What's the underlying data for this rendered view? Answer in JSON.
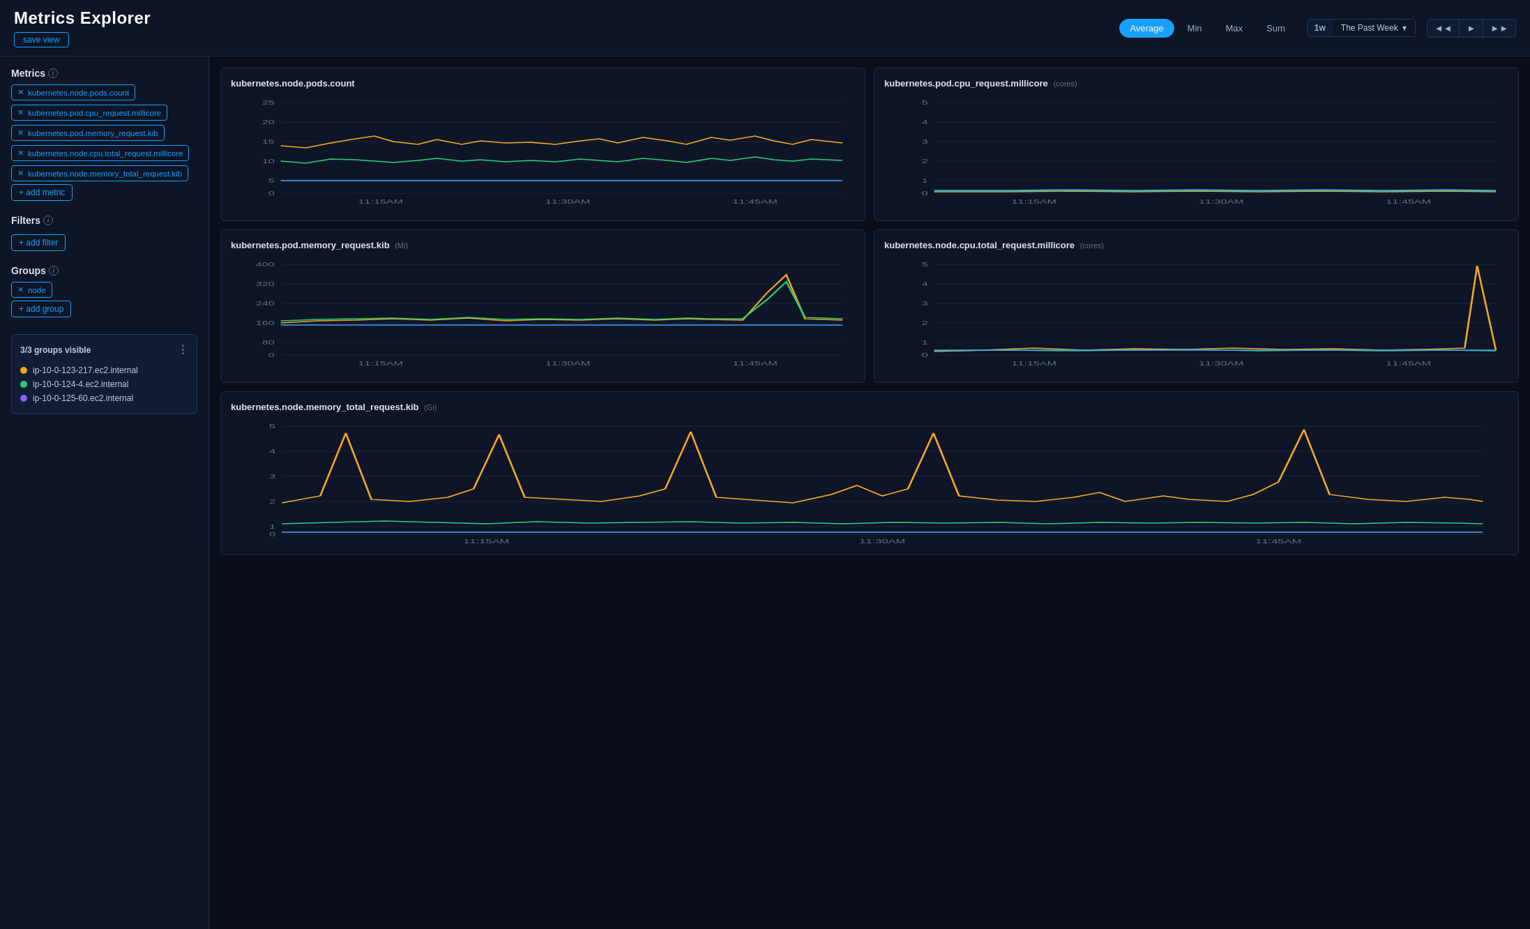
{
  "header": {
    "title": "Metrics Explorer",
    "save_view_label": "save view",
    "agg_buttons": [
      {
        "label": "Average",
        "active": true
      },
      {
        "label": "Min",
        "active": false
      },
      {
        "label": "Max",
        "active": false
      },
      {
        "label": "Sum",
        "active": false
      }
    ],
    "time_preset": "1w",
    "time_label": "The Past Week",
    "time_nav": [
      "◄◄",
      "►",
      "►►"
    ]
  },
  "sidebar": {
    "metrics_title": "Metrics",
    "filters_title": "Filters",
    "groups_title": "Groups",
    "add_metric_label": "+ add metric",
    "add_filter_label": "+ add filter",
    "add_group_label": "+ add group",
    "metrics": [
      "kubernetes.node.pods.count",
      "kubernetes.pod.cpu_request.millicore",
      "kubernetes.pod.memory_request.kib",
      "kubernetes.node.cpu.total_request.millicore",
      "kubernetes.node.memory_total_request.kib"
    ],
    "groups": [
      "node"
    ],
    "groups_visible_label": "3/3 groups visible",
    "group_items": [
      {
        "label": "ip-10-0-123-217.ec2.internal",
        "color": "#f5a623"
      },
      {
        "label": "ip-10-0-124-4.ec2.internal",
        "color": "#2ecc71"
      },
      {
        "label": "ip-10-0-125-60.ec2.internal",
        "color": "#8b5cf6"
      }
    ]
  },
  "charts": [
    {
      "id": "pods_count",
      "title": "kubernetes.node.pods.count",
      "unit": "",
      "wide": false,
      "y_max": 25,
      "y_labels": [
        "25",
        "20",
        "15",
        "10",
        "5",
        "0"
      ],
      "x_labels": [
        "11:15AM",
        "11:30AM",
        "11:45AM"
      ]
    },
    {
      "id": "cpu_request",
      "title": "kubernetes.pod.cpu_request.millicore",
      "unit": "(cores)",
      "wide": false,
      "y_max": 5,
      "y_labels": [
        "5",
        "4",
        "3",
        "2",
        "1",
        "0"
      ],
      "x_labels": [
        "11:15AM",
        "11:30AM",
        "11:45AM"
      ]
    },
    {
      "id": "memory_request",
      "title": "kubernetes.pod.memory_request.kib",
      "unit": "(Mi)",
      "wide": false,
      "y_max": 400,
      "y_labels": [
        "400",
        "320",
        "240",
        "160",
        "80",
        "0"
      ],
      "x_labels": [
        "11:15AM",
        "11:30AM",
        "11:45AM"
      ]
    },
    {
      "id": "cpu_total",
      "title": "kubernetes.node.cpu.total_request.millicore",
      "unit": "(cores)",
      "wide": false,
      "y_max": 5,
      "y_labels": [
        "5",
        "4",
        "3",
        "2",
        "1",
        "0"
      ],
      "x_labels": [
        "11:15AM",
        "11:30AM",
        "11:45AM"
      ]
    },
    {
      "id": "memory_total",
      "title": "kubernetes.node.memory_total_request.kib",
      "unit": "(Gi)",
      "wide": false,
      "y_max": 5,
      "y_labels": [
        "5",
        "4",
        "3",
        "2",
        "1",
        "0"
      ],
      "x_labels": [
        "11:15AM",
        "11:30AM",
        "11:45AM"
      ]
    }
  ],
  "colors": {
    "orange": "#f5a623",
    "green": "#2ecc71",
    "blue": "#4a9eff",
    "purple": "#8b5cf6",
    "accent": "#1a9fff",
    "bg_dark": "#0a0e1a",
    "bg_panel": "#0d1526",
    "border": "#1e2d4a"
  }
}
